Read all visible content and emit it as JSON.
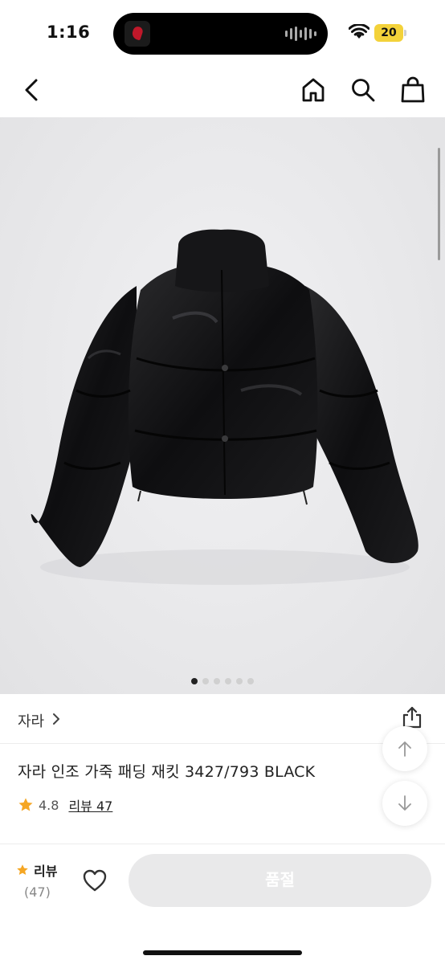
{
  "status_bar": {
    "time": "1:16",
    "battery": "20"
  },
  "brand": {
    "name": "자라"
  },
  "product": {
    "title": "자라 인조 가죽 패딩 재킷 3427/793 BLACK",
    "rating": "4.8",
    "review_link": "리뷰 47",
    "image_count": 6,
    "active_image": 1
  },
  "bottom_bar": {
    "review_label": "리뷰",
    "review_count": "(47)",
    "buy_button": "품절"
  },
  "colors": {
    "star": "#f5a623",
    "soldout_bg": "#e9e9ea",
    "battery": "#f3d23a"
  },
  "icons": [
    "back-arrow-icon",
    "home-icon",
    "search-icon",
    "shopping-bag-icon",
    "share-icon",
    "arrow-up-icon",
    "arrow-down-icon",
    "star-icon",
    "heart-icon"
  ]
}
